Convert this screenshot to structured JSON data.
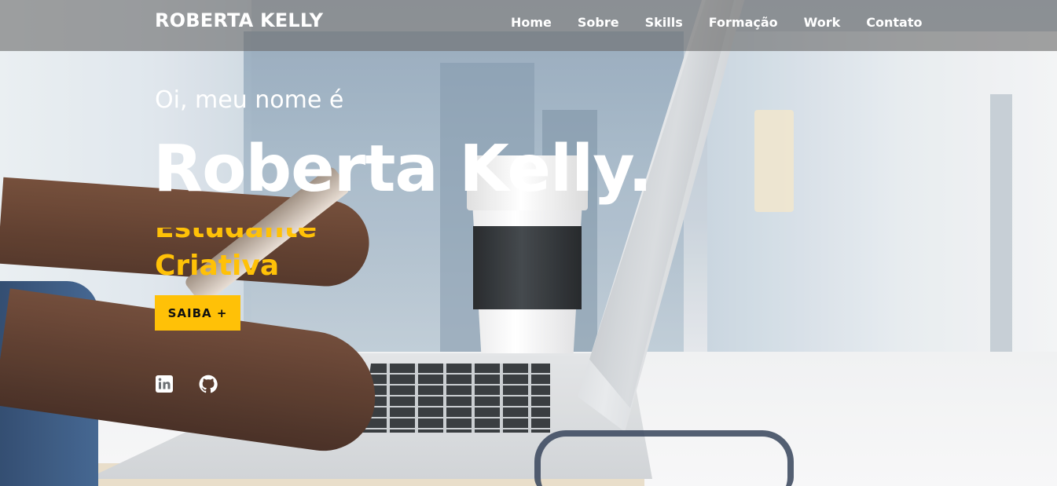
{
  "header": {
    "brand": "ROBERTA KELLY",
    "nav": [
      "Home",
      "Sobre",
      "Skills",
      "Formação",
      "Work",
      "Contato"
    ]
  },
  "hero": {
    "greeting": "Oi, meu nome é",
    "name": "Roberta Kelly.",
    "typed_previous": "Estudante",
    "typed_current": "Criativa",
    "cta_label": "SAIBA +"
  },
  "social": {
    "icons": [
      "linkedin-icon",
      "github-icon"
    ]
  },
  "colors": {
    "accent": "#ffc107",
    "header_bg": "#6c6c6c"
  }
}
